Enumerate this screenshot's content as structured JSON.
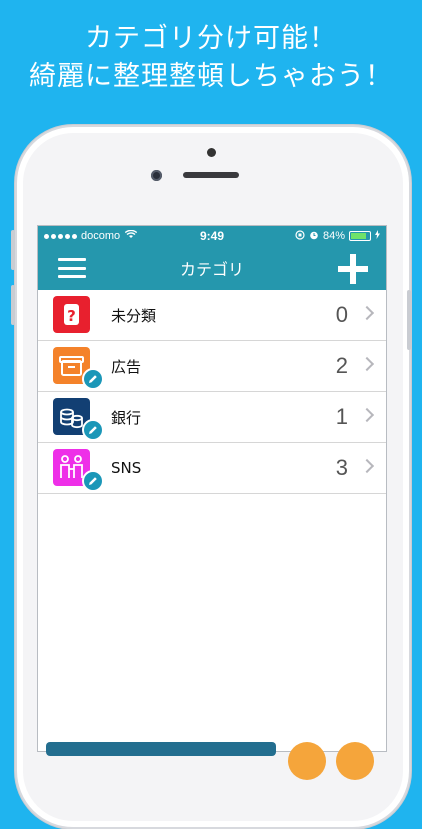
{
  "headline": {
    "line1": "カテゴリ分け可能！",
    "line2": "綺麗に整理整頓しちゃおう！"
  },
  "status_bar": {
    "carrier": "docomo",
    "time": "9:49",
    "battery": "84%",
    "battery_level": 0.84
  },
  "nav": {
    "title": "カテゴリ"
  },
  "categories": [
    {
      "name": "未分類",
      "count": "0",
      "icon": "question-icon",
      "color": "#e8202e",
      "editable": false
    },
    {
      "name": "広告",
      "count": "2",
      "icon": "gift-box-icon",
      "color": "#f4822a",
      "editable": true
    },
    {
      "name": "銀行",
      "count": "1",
      "icon": "coins-icon",
      "color": "#123f73",
      "editable": true
    },
    {
      "name": "SNS",
      "count": "3",
      "icon": "people-icon",
      "color": "#ee2fe8",
      "editable": true
    }
  ],
  "colors": {
    "background": "#1fb4ef",
    "nav": "#2597ad",
    "edit_badge": "#1b97b8"
  }
}
